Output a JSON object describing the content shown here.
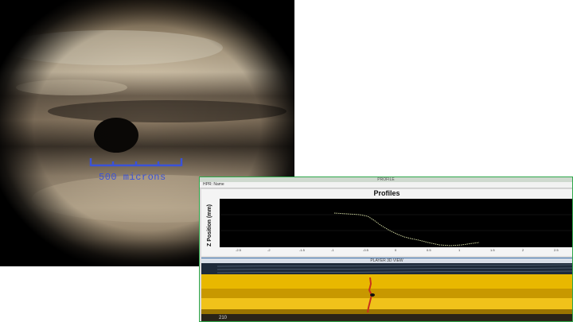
{
  "micrograph": {
    "scale_label": "500 microns"
  },
  "window": {
    "title": "PROFILE",
    "toolbar_label": "HPR: Name",
    "profile_title": "Profiles",
    "y_axis_label": "Z Position (mm)",
    "x_ticks": [
      "-2.5",
      "-2",
      "-1.5",
      "-1",
      "-0.5",
      "0",
      "0.5",
      "1",
      "1.5",
      "2",
      "2.5"
    ],
    "view_title": "PLAYER 3D VIEW",
    "view_number": "210"
  },
  "colors": {
    "window_border": "#2ea84a",
    "surface": "#e8b800",
    "crack": "#c8301c",
    "scale_bar": "#3a52d8"
  }
}
